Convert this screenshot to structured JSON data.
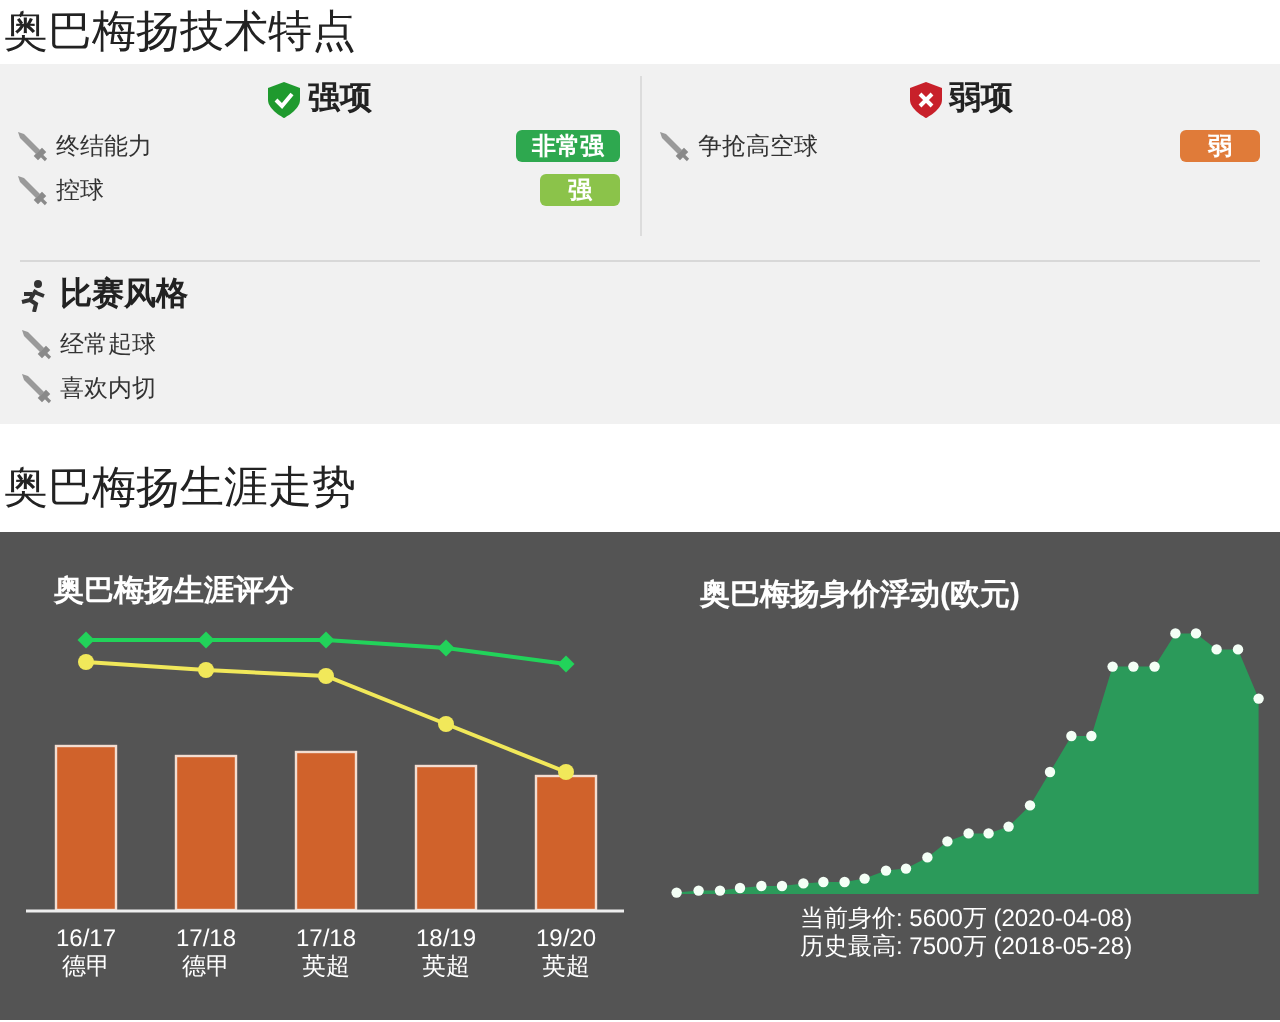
{
  "skills_title": "奥巴梅扬技术特点",
  "strengths": {
    "title": "强项",
    "items": [
      {
        "label": "终结能力",
        "badge": "非常强",
        "color": "#2ea84f"
      },
      {
        "label": "控球",
        "badge": "强",
        "color": "#8bc34a"
      }
    ]
  },
  "weaknesses": {
    "title": "弱项",
    "items": [
      {
        "label": "争抢高空球",
        "badge": "弱",
        "color": "#e07b39"
      }
    ]
  },
  "style": {
    "title": "比赛风格",
    "items": [
      "经常起球",
      "喜欢内切"
    ]
  },
  "career_title": "奥巴梅扬生涯走势",
  "rating_chart": {
    "title": "奥巴梅扬生涯评分",
    "categories": [
      [
        "16/17",
        "德甲"
      ],
      [
        "17/18",
        "德甲"
      ],
      [
        "17/18",
        "英超"
      ],
      [
        "18/19",
        "英超"
      ],
      [
        "19/20",
        "英超"
      ]
    ]
  },
  "value_chart": {
    "title": "奥巴梅扬身价浮动(欧元)",
    "current": "当前身价: 5600万 (2020-04-08)",
    "peak": "历史最高: 7500万 (2018-05-28)"
  }
}
